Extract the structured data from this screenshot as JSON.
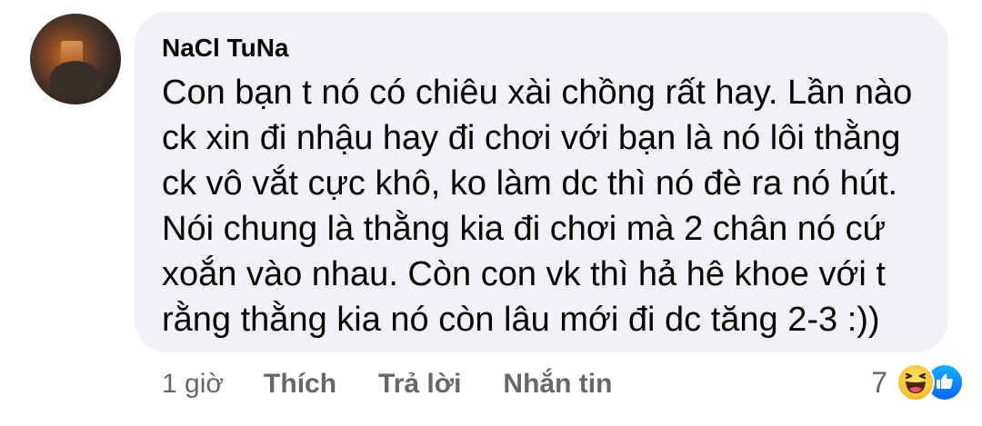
{
  "comment": {
    "author": "NaCl TuNa",
    "lines": [
      "Con bạn t nó có chiêu xài chồng rất hay. Lần nào",
      "ck xin đi nhậu hay đi chơi với bạn là nó lôi thằng",
      "ck vô vắt cực khô, ko làm dc  thì nó đè ra nó hút.",
      "Nói chung là thằng kia đi chơi mà 2 chân nó cứ",
      "xoắn vào nhau. Còn con vk thì hả hê khoe với t",
      "rằng thằng kia nó còn lâu mới đi dc tăng 2-3 :))"
    ]
  },
  "meta": {
    "time": "1 giờ",
    "like_label": "Thích",
    "reply_label": "Trả lời",
    "message_label": "Nhắn tin"
  },
  "reactions": {
    "count": "7",
    "icons": [
      "haha-icon",
      "like-icon"
    ]
  },
  "colors": {
    "bubble": "#f0f2f5",
    "text": "#050505",
    "meta": "#65676b",
    "like": "#0866ff",
    "haha": "#f7c53a"
  }
}
